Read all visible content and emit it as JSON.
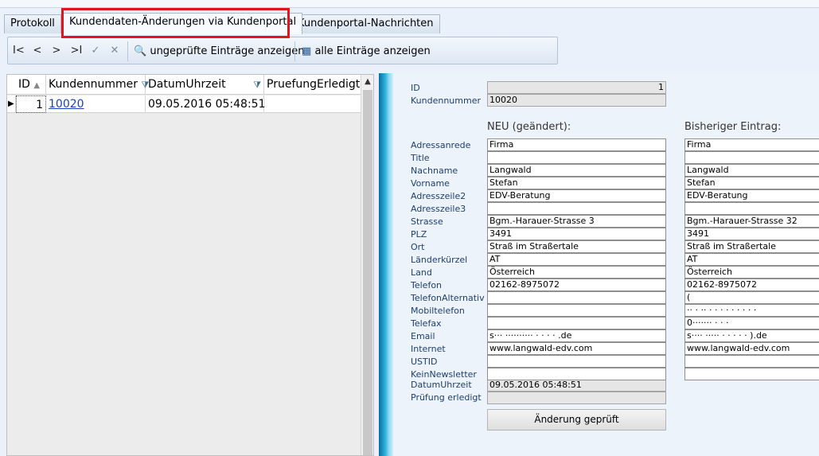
{
  "tabs": [
    {
      "label": "Protokoll",
      "active": false
    },
    {
      "label": "Kundendaten-Änderungen via Kundenportal",
      "active": true
    },
    {
      "label": "Kundenportal-Nachrichten",
      "active": false
    }
  ],
  "toolbar": {
    "nav": {
      "first": "I<",
      "prev": "<",
      "next": ">",
      "last": ">I",
      "confirm": "✓",
      "cancel": "✕"
    },
    "search_glyph": "🔍",
    "grid_glyph": "▦",
    "unchecked_label": "ungeprüfte Einträge anzeigen",
    "all_label": "alle Einträge anzeigen"
  },
  "grid": {
    "columns": {
      "id": "ID",
      "kundennummer": "Kundennummer",
      "datum": "DatumUhrzeit",
      "erledigt": "PruefungErledigt"
    },
    "sort_glyph": "▲",
    "filter_glyph": "⧩",
    "row_marker": "▶",
    "rows": [
      {
        "id": "1",
        "kundennummer": "10020",
        "datum": "09.05.2016 05:48:51",
        "erledigt": ""
      }
    ]
  },
  "detail": {
    "id_label": "ID",
    "id_value": "1",
    "kundennummer_label": "Kundennummer",
    "kundennummer_value": "10020",
    "new_header": "NEU (geändert):",
    "old_header": "Bisheriger Eintrag:",
    "fields": [
      {
        "label": "Adressanrede",
        "new": "Firma",
        "old": "Firma"
      },
      {
        "label": "Title",
        "new": "",
        "old": ""
      },
      {
        "label": "Nachname",
        "new": "Langwald",
        "old": "Langwald"
      },
      {
        "label": "Vorname",
        "new": "Stefan",
        "old": "Stefan"
      },
      {
        "label": "Adresszeile2",
        "new": "EDV-Beratung",
        "old": "EDV-Beratung"
      },
      {
        "label": "Adresszeile3",
        "new": "",
        "old": ""
      },
      {
        "label": "Strasse",
        "new": "Bgm.-Harauer-Strasse 3",
        "old": "Bgm.-Harauer-Strasse 32"
      },
      {
        "label": "PLZ",
        "new": "3491",
        "old": "3491"
      },
      {
        "label": "Ort",
        "new": "Straß im Straßertale",
        "old": "Straß im Straßertale"
      },
      {
        "label": "Länderkürzel",
        "new": "AT",
        "old": "AT"
      },
      {
        "label": "Land",
        "new": "Österreich",
        "old": "Österreich"
      },
      {
        "label": "Telefon",
        "new": "02162-8975072",
        "old": "02162-8975072"
      },
      {
        "label": "TelefonAlternativ",
        "new": "",
        "old": "("
      },
      {
        "label": "Mobiltelefon",
        "new": "",
        "old": "·· · ·· · · · · · · · · ·"
      },
      {
        "label": "Telefax",
        "new": "",
        "old": "0······· · · ·"
      },
      {
        "label": "Email",
        "new": "s··· ·········· · · ·  ·  .de",
        "old": "s···· ····· · · · · ·  ).de"
      },
      {
        "label": "Internet",
        "new": "www.langwald-edv.com",
        "old": "www.langwald-edv.com"
      },
      {
        "label": "USTID",
        "new": "",
        "old": ""
      },
      {
        "label": "KeinNewsletter",
        "new": "",
        "old": ""
      }
    ],
    "datum_label": "DatumUhrzeit",
    "datum_value": "09.05.2016 05:48:51",
    "pruefung_label": "Prüfung erledigt",
    "pruefung_value": "",
    "button_label": "Änderung geprüft"
  }
}
